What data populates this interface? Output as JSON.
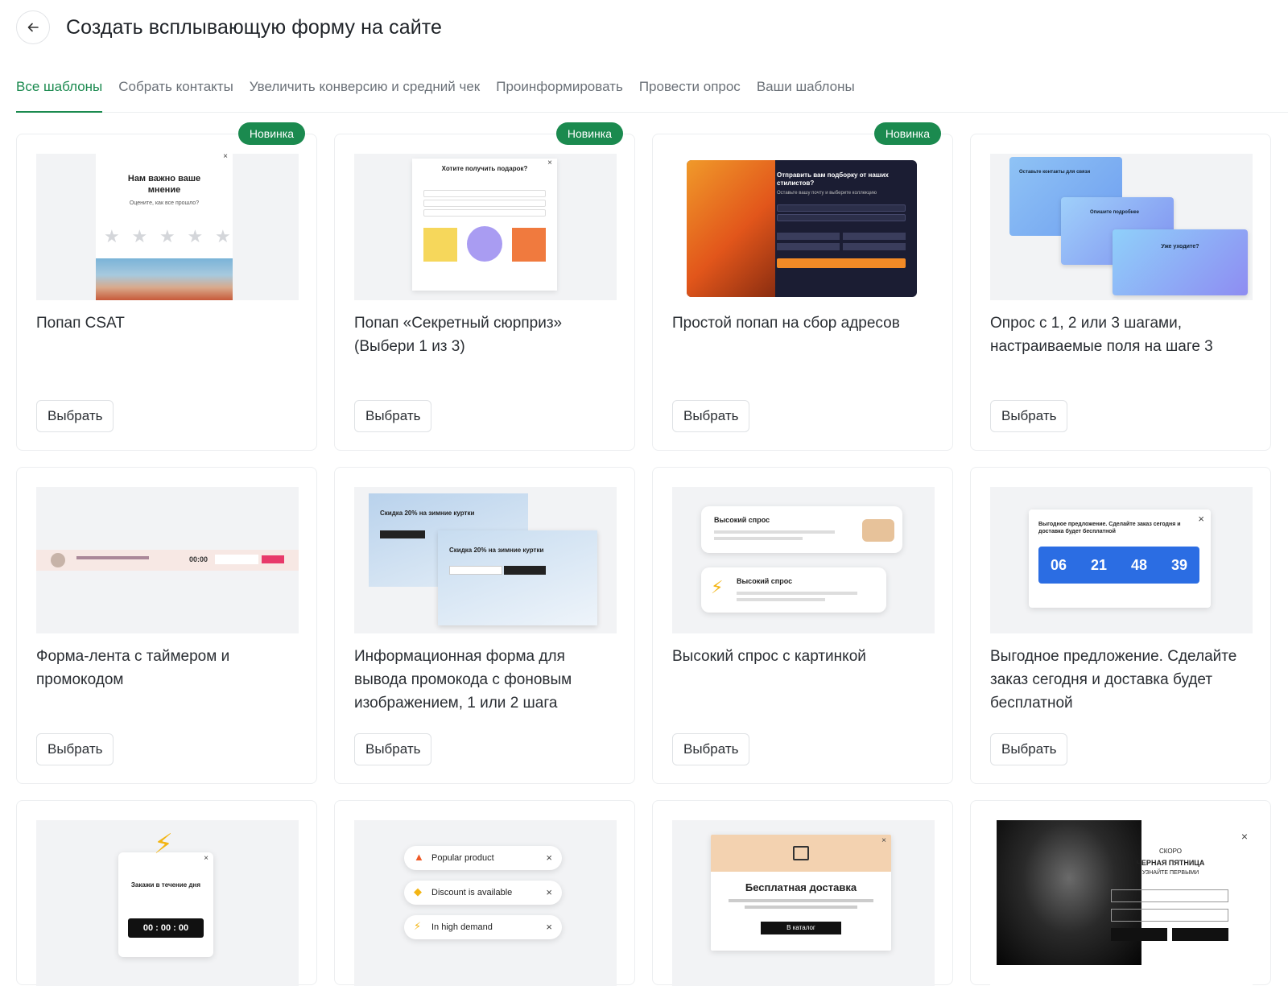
{
  "header": {
    "title": "Создать всплывающую форму на сайте"
  },
  "tabs": [
    {
      "label": "Все шаблоны"
    },
    {
      "label": "Собрать контакты"
    },
    {
      "label": "Увеличить конверсию и средний чек"
    },
    {
      "label": "Проинформировать"
    },
    {
      "label": "Провести опрос"
    },
    {
      "label": "Ваши шаблоны"
    }
  ],
  "badge_label": "Новинка",
  "select_label": "Выбрать",
  "cards": [
    {
      "title": "Попап CSAT",
      "preview": {
        "heading": "Нам важно ваше мнение",
        "sub": "Оцените, как все прошло?"
      }
    },
    {
      "title": "Попап «Секретный сюрприз» (Выбери 1 из 3)",
      "preview": {
        "heading": "Хотите получить подарок?"
      }
    },
    {
      "title": "Простой попап на сбор адресов",
      "preview": {
        "heading": "Отправить вам подборку от наших стилистов?",
        "sub": "Оставьте вашу почту и выберите коллекцию"
      }
    },
    {
      "title": "Опрос с 1, 2 или 3 шагами, настраиваемые поля на шаге 3",
      "preview": {
        "s1": "Оставьте контакты для связи",
        "s2": "Опишите подробнее",
        "s3": "Уже уходите?"
      }
    },
    {
      "title": "Форма-лента с таймером и промокодом",
      "preview": {
        "timer": "00:00"
      }
    },
    {
      "title": "Информационная форма для вывода промокода с фоновым изображением, 1 или 2 шага",
      "preview": {
        "heading": "Скидка 20% на зимние куртки"
      }
    },
    {
      "title": "Высокий спрос с картинкой",
      "preview": {
        "heading": "Высокий спрос"
      }
    },
    {
      "title": "Выгодное предложение. Сделайте заказ сегодня и доставка будет бесплатной",
      "preview": {
        "heading": "Выгодное предложение. Сделайте заказ сегодня и доставка будет бесплатной",
        "d": "06",
        "h": "21",
        "m": "48",
        "s": "39"
      }
    },
    {
      "preview": {
        "heading": "Закажи в течение дня",
        "timer": "00 : 00 : 00"
      }
    },
    {
      "preview": {
        "n1": "Popular product",
        "n2": "Discount is available",
        "n3": "In high demand"
      }
    },
    {
      "preview": {
        "heading": "Бесплатная доставка",
        "btn": "В каталог"
      }
    },
    {
      "preview": {
        "l1": "СКОРО",
        "l2": "ЧЕРНАЯ ПЯТНИЦА",
        "l3": "УЗНАЙТЕ ПЕРВЫМИ"
      }
    }
  ],
  "colors": {
    "accent": "#1b8a4f",
    "border": "#eceef0"
  }
}
